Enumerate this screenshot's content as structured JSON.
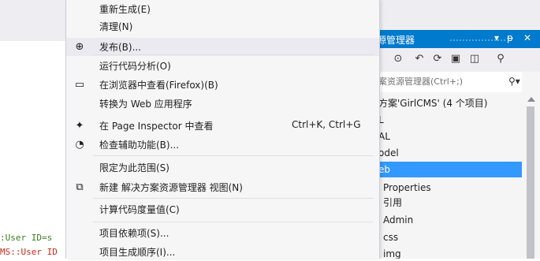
{
  "context_menu": {
    "items": [
      {
        "label": "重新生成(E)",
        "shortcut": "",
        "icon": "",
        "icon_name": ""
      },
      {
        "label": "清理(N)",
        "shortcut": "",
        "icon": "",
        "icon_name": ""
      },
      {
        "label": "发布(B)...",
        "shortcut": "",
        "icon": "⊕",
        "icon_name": "publish-globe-icon"
      },
      {
        "label": "运行代码分析(O)",
        "shortcut": "",
        "icon": "",
        "icon_name": ""
      },
      {
        "label": "在浏览器中查看(Firefox)(B)",
        "shortcut": "",
        "icon": "▭",
        "icon_name": "view-in-browser-icon"
      },
      {
        "label": "转换为 Web 应用程序",
        "shortcut": "",
        "icon": "",
        "icon_name": ""
      },
      {
        "label": "在 Page Inspector 中查看",
        "shortcut": "Ctrl+K, Ctrl+G",
        "icon": "✦",
        "icon_name": "page-inspector-icon"
      },
      {
        "label": "检查辅助功能(B)...",
        "shortcut": "",
        "icon": "◔",
        "icon_name": "accessibility-check-icon"
      },
      {
        "label": "限定为此范围(S)",
        "shortcut": "",
        "icon": "",
        "icon_name": ""
      },
      {
        "label": "新建 解决方案资源管理器 视图(N)",
        "shortcut": "",
        "icon": "⧉",
        "icon_name": "new-solution-explorer-view-icon"
      },
      {
        "label": "计算代码度量值(C)",
        "shortcut": "",
        "icon": "",
        "icon_name": ""
      },
      {
        "label": "项目依赖项(S)...",
        "shortcut": "",
        "icon": "",
        "icon_name": ""
      },
      {
        "label": "项目生成顺序(I)...",
        "shortcut": "",
        "icon": "",
        "icon_name": ""
      }
    ],
    "hover_index": 2
  },
  "solution_explorer": {
    "title": "源管理器",
    "pin": "ᵽ",
    "close": "✕",
    "dropdown": "▾",
    "search_placeholder": "案资源管理器(Ctrl+;)",
    "toolbar_icons": [
      "⊙",
      "↶",
      "⟳",
      "▣",
      "◫",
      "⚲"
    ],
    "tree": [
      {
        "label": "方案'GirlCMS' (4 个项目)"
      },
      {
        "label": "L"
      },
      {
        "label": "AL"
      },
      {
        "label": "odel"
      },
      {
        "label": "eb",
        "selected": true
      },
      {
        "label": "Properties"
      },
      {
        "label": "引用"
      },
      {
        "label": "Admin"
      },
      {
        "label": "css"
      },
      {
        "label": "img"
      }
    ]
  },
  "editor": {
    "lines": [
      ":User ID=s",
      "MS::User ID"
    ]
  },
  "colors": {
    "accent": "#007acc",
    "selection": "#3399ff",
    "menu_bg": "#f6f6f6"
  }
}
